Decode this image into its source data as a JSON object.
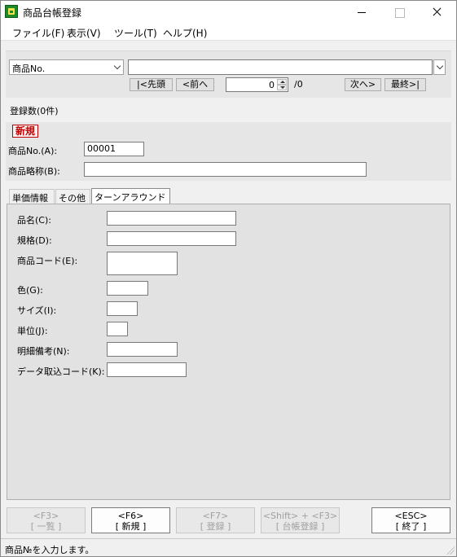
{
  "window": {
    "title": "商品台帳登録"
  },
  "menu": [
    {
      "label": "ファイル(F)"
    },
    {
      "label": "表示(V)"
    },
    {
      "label": "ツール(T)"
    },
    {
      "label": "ヘルプ(H)"
    }
  ],
  "search": {
    "field_select": "商品No.",
    "value": "",
    "nav": {
      "first": "|<先頭",
      "prev": "<前へ",
      "next": "次へ>",
      "last": "最終>|"
    },
    "page": "0",
    "total": "/0"
  },
  "count_label": "登録数(0件)",
  "entry": {
    "mode_badge": "新規",
    "product_no_label": "商品No.(A):",
    "product_no_value": "00001",
    "short_name_label": "商品略称(B):",
    "short_name_value": ""
  },
  "tabs": [
    {
      "label": "単価情報"
    },
    {
      "label": "その他"
    },
    {
      "label": "ターンアラウンド用"
    }
  ],
  "turnaround_fields": [
    {
      "label": "品名(C):",
      "value": ""
    },
    {
      "label": "規格(D):",
      "value": ""
    },
    {
      "label": "商品コード(E):",
      "value": ""
    },
    {
      "label": "色(G):",
      "value": ""
    },
    {
      "label": "サイズ(I):",
      "value": ""
    },
    {
      "label": "単位(J):",
      "value": ""
    },
    {
      "label": "明細備考(N):",
      "value": ""
    },
    {
      "label": "データ取込コード(K):",
      "value": ""
    }
  ],
  "function_keys": [
    {
      "key": "<F3>",
      "label": "[ 一覧 ]",
      "enabled": false
    },
    {
      "key": "<F6>",
      "label": "[ 新規 ]",
      "enabled": true
    },
    {
      "key": "<F7>",
      "label": "[ 登録 ]",
      "enabled": false
    },
    {
      "key": "<Shift> + <F3>",
      "label": "[ 台帳登録 ]",
      "enabled": false
    },
    {
      "key": "<ESC>",
      "label": "[ 終了 ]",
      "enabled": true
    }
  ],
  "status": {
    "text": "商品№を入力します。"
  },
  "colors": {
    "badge_red": "#c00000",
    "app_icon_green": "#1d8a2a"
  }
}
